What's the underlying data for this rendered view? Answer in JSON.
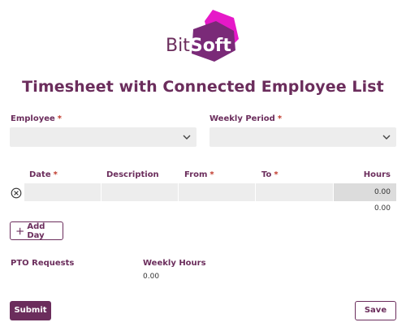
{
  "logo": {
    "bit": "Bit",
    "soft": "Soft",
    "colors": {
      "magenta": "#e619c8",
      "purple": "#7a2a78"
    }
  },
  "title": "Timesheet with Connected Employee List",
  "fields": {
    "employee": {
      "label": "Employee",
      "required_mark": "*",
      "value": ""
    },
    "weekly_period": {
      "label": "Weekly Period",
      "required_mark": "*",
      "value": ""
    }
  },
  "table": {
    "columns": [
      {
        "label": "Date",
        "required_mark": "*"
      },
      {
        "label": "Description",
        "required_mark": ""
      },
      {
        "label": "From",
        "required_mark": "*"
      },
      {
        "label": "To",
        "required_mark": "*"
      },
      {
        "label": "Hours",
        "required_mark": ""
      }
    ],
    "rows": [
      {
        "date": "",
        "description": "",
        "from": "",
        "to": "",
        "hours": "0.00"
      }
    ],
    "total": "0.00"
  },
  "add_day_label": "Add Day",
  "summary": {
    "pto_label": "PTO Requests",
    "weekly_hours_label": "Weekly Hours",
    "weekly_hours_value": "0.00"
  },
  "buttons": {
    "submit": "Submit",
    "save": "Save"
  },
  "colors": {
    "accent": "#6b2d5c",
    "required": "#c0392b",
    "field_bg": "#ededed"
  }
}
